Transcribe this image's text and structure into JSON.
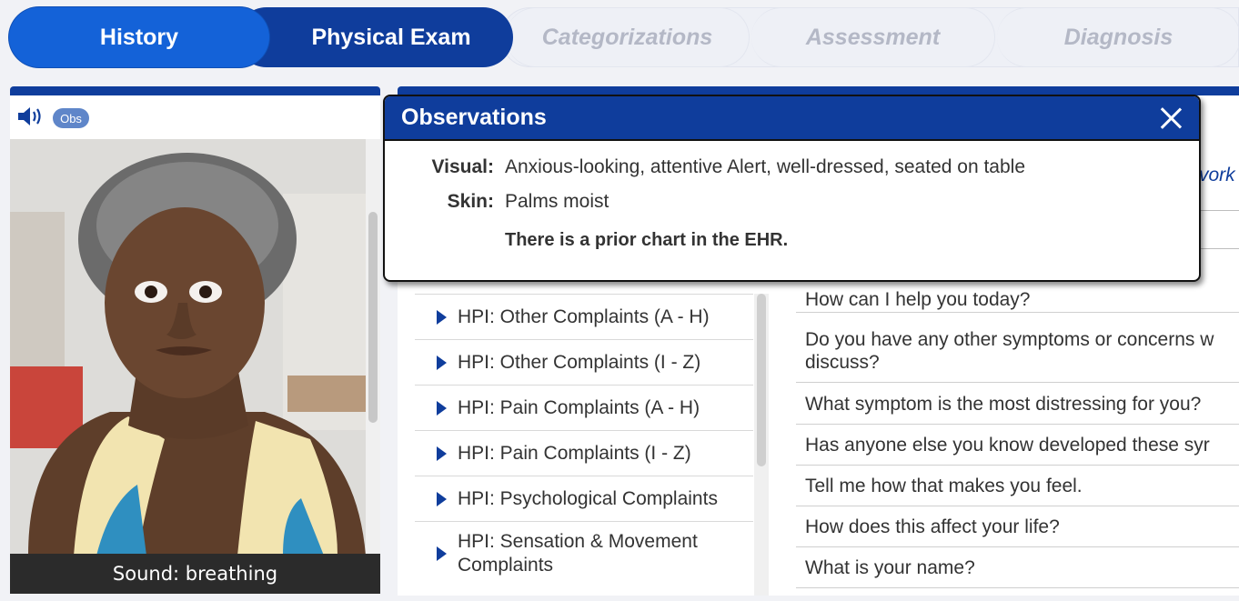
{
  "tabs": {
    "history": "History",
    "physical_exam": "Physical Exam",
    "categorizations": "Categorizations",
    "assessment": "Assessment",
    "diagnosis": "Diagnosis"
  },
  "patient_panel": {
    "obs_button": "Obs",
    "caption": "Sound: breathing"
  },
  "categories": [
    "HPI: Other Complaints (A - H)",
    "HPI: Other Complaints (I - Z)",
    "HPI: Pain Complaints (A - H)",
    "HPI: Pain Complaints (I - Z)",
    "HPI: Psychological Complaints",
    "HPI: Sensation & Movement Complaints"
  ],
  "questions": {
    "work_partial": "vork",
    "items": [
      "How can I help you today?",
      "Do you have any other symptoms or concerns w discuss?",
      "What symptom is the most distressing for you?",
      "Has anyone else you know developed these syr",
      "Tell me how that makes you feel.",
      "How does this affect your life?",
      "What is your name?"
    ]
  },
  "observations": {
    "title": "Observations",
    "visual_label": "Visual:",
    "visual_value": "Anxious-looking, attentive Alert, well-dressed, seated on table",
    "skin_label": "Skin:",
    "skin_value": "Palms moist",
    "prior_chart": "There is a prior chart in the EHR."
  },
  "colors": {
    "primary_dark": "#0f3d9c",
    "primary": "#1462d8",
    "inactive_tab_text": "#b4b8c6"
  }
}
